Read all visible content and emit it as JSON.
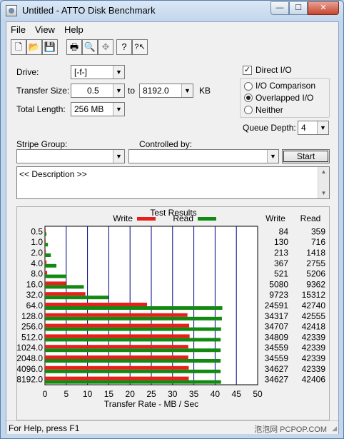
{
  "window": {
    "title": "Untitled - ATTO Disk Benchmark",
    "min": "—",
    "max": "☐",
    "close": "✕"
  },
  "menu": {
    "file": "File",
    "view": "View",
    "help": "Help"
  },
  "toolbar": {
    "new": "🗋",
    "open": "📂",
    "save": "💾",
    "print": "🖶",
    "preview": "🔍",
    "move": "✥",
    "help": "?",
    "context_help": "?↖"
  },
  "settings": {
    "drive_label": "Drive:",
    "drive_value": "[-f-]",
    "transfer_size_label": "Transfer Size:",
    "transfer_from": "0.5",
    "to_label": "to",
    "transfer_to": "8192.0",
    "kb_label": "KB",
    "total_length_label": "Total Length:",
    "total_length_value": "256 MB",
    "direct_io_label": "Direct I/O",
    "direct_io_checked": true,
    "io_comparison_label": "I/O Comparison",
    "overlapped_io_label": "Overlapped I/O",
    "neither_label": "Neither",
    "selected_mode": "Overlapped I/O",
    "queue_depth_label": "Queue Depth:",
    "queue_depth_value": "4",
    "stripe_group_label": "Stripe Group:",
    "stripe_group_value": "",
    "controlled_by_label": "Controlled by:",
    "controlled_by_value": "",
    "start_label": "Start",
    "description": "<< Description >>"
  },
  "status_bar": {
    "text": "For Help, press F1",
    "watermark": "泡泡网 PCPOP.COM"
  },
  "chart_data": {
    "type": "bar",
    "title": "Test Results",
    "xlabel": "Transfer Rate - MB / Sec",
    "xlim": [
      0,
      50
    ],
    "xticks": [
      0,
      5,
      10,
      15,
      20,
      25,
      30,
      35,
      40,
      45,
      50
    ],
    "categories": [
      "0.5",
      "1.0",
      "2.0",
      "4.0",
      "8.0",
      "16.0",
      "32.0",
      "64.0",
      "128.0",
      "256.0",
      "512.0",
      "1024.0",
      "2048.0",
      "4096.0",
      "8192.0"
    ],
    "series": [
      {
        "name": "Write",
        "color": "#e8201c",
        "values": [
          0.08,
          0.13,
          0.21,
          0.36,
          0.51,
          4.96,
          9.5,
          24.0,
          33.5,
          33.9,
          34.0,
          33.7,
          33.7,
          33.8,
          33.8
        ]
      },
      {
        "name": "Read",
        "color": "#128a12",
        "values": [
          0.35,
          0.7,
          1.38,
          2.69,
          5.08,
          9.14,
          14.95,
          41.7,
          41.6,
          41.4,
          41.3,
          41.3,
          41.3,
          41.3,
          41.4
        ]
      }
    ],
    "table_headers": [
      "Write",
      "Read"
    ],
    "table": [
      [
        "84",
        "359"
      ],
      [
        "130",
        "716"
      ],
      [
        "213",
        "1418"
      ],
      [
        "367",
        "2755"
      ],
      [
        "521",
        "5206"
      ],
      [
        "5080",
        "9362"
      ],
      [
        "9723",
        "15312"
      ],
      [
        "24591",
        "42740"
      ],
      [
        "34317",
        "42555"
      ],
      [
        "34707",
        "42418"
      ],
      [
        "34809",
        "42339"
      ],
      [
        "34559",
        "42339"
      ],
      [
        "34559",
        "42339"
      ],
      [
        "34627",
        "42339"
      ],
      [
        "34627",
        "42406"
      ]
    ],
    "grid": true,
    "legend": "top-center"
  }
}
